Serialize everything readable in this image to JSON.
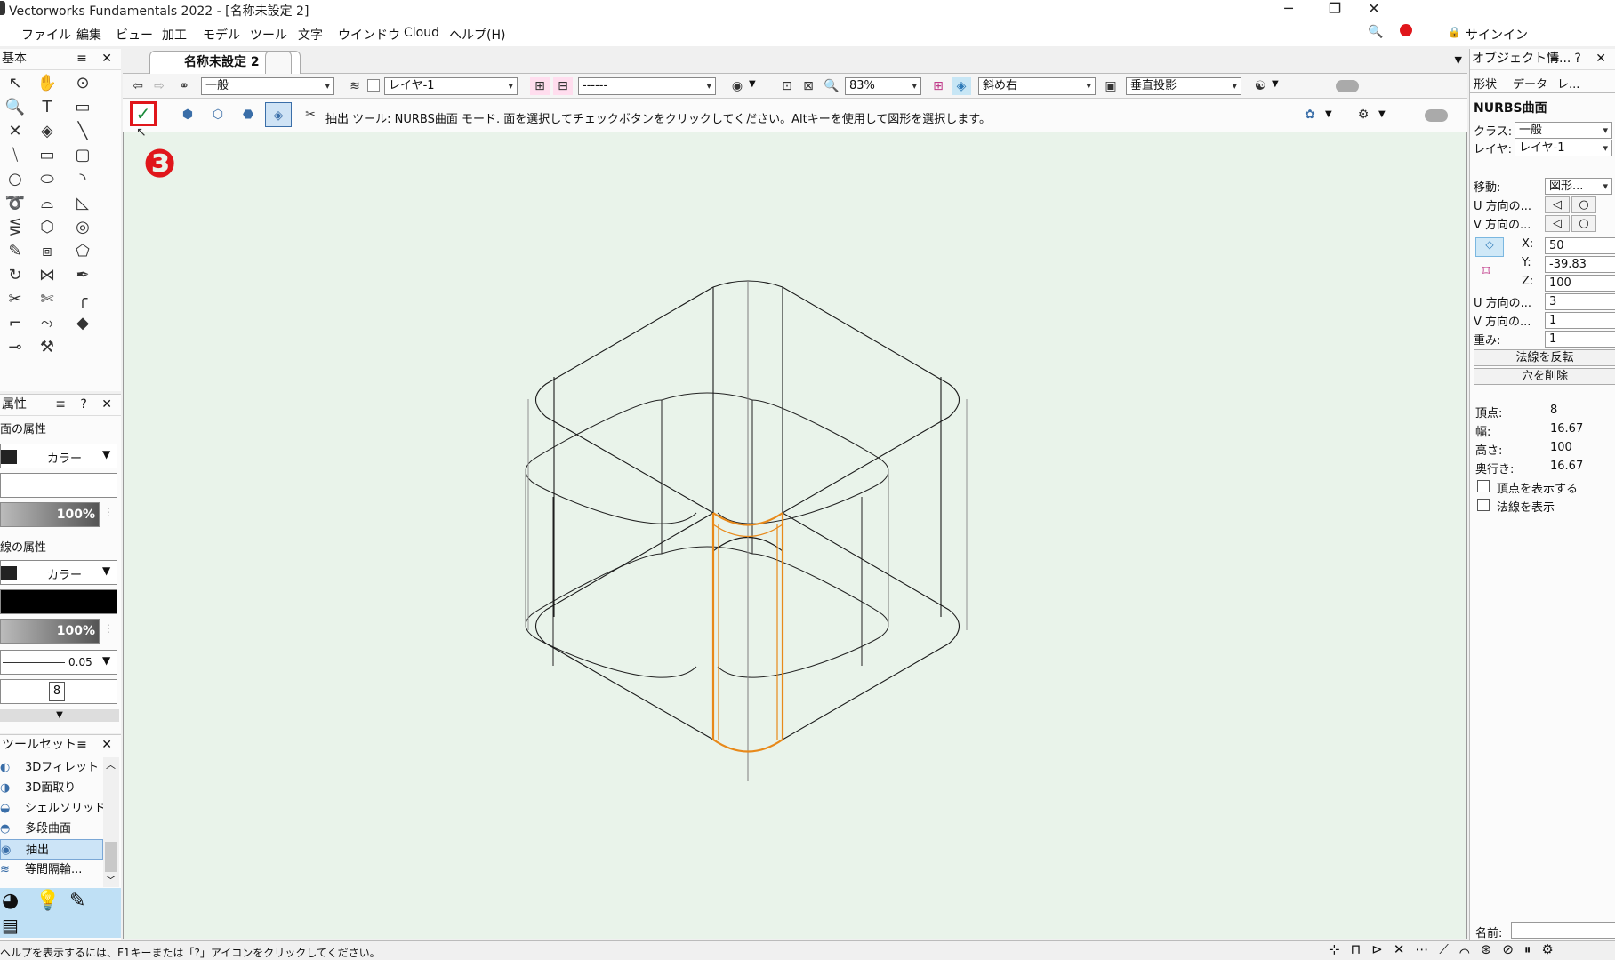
{
  "window": {
    "title": "Vectorworks Fundamentals 2022 - [名称未設定 2]",
    "minimize": "─",
    "restore": "❐",
    "close": "✕"
  },
  "menu": [
    "ファイル",
    "編集",
    "ビュー",
    "加工",
    "モデル",
    "ツール",
    "文字",
    "ウインドウ",
    "Cloud",
    "ヘルプ(H)"
  ],
  "menu_right": {
    "signin": "サインイン"
  },
  "basic_palette": {
    "title": "基本"
  },
  "attributes": {
    "title": "属性",
    "fill_section": "面の属性",
    "fill_type": "カラー",
    "fill_opacity": "100%",
    "pen_section": "線の属性",
    "pen_type": "カラー",
    "pen_opacity": "100%",
    "line_weight": "0.05",
    "marker_value": "8"
  },
  "toolsets": {
    "title": "ツールセット",
    "items": [
      "3Dフィレット",
      "3D面取り",
      "シェルソリッド",
      "多段曲面",
      "抽出",
      "等間隔輪..."
    ]
  },
  "document_tab": {
    "label": "名称未設定 2",
    "close": "✕"
  },
  "view_bar": {
    "class": "一般",
    "layer": "レイヤ-1",
    "saved_view": "------",
    "zoom": "83%",
    "view": "斜め右",
    "projection": "垂直投影"
  },
  "mode_bar": {
    "help_text": "抽出 ツール: NURBS曲面 モード. 面を選択してチェックボタンをクリックしてください。Altキーを使用して図形を選択します。"
  },
  "annotation": {
    "step": "❸"
  },
  "oip": {
    "title": "オブジェクト情...",
    "tabs": [
      "形状",
      "データ",
      "レ..."
    ],
    "object_type": "NURBS曲面",
    "class_label": "クラス:",
    "class_value": "一般",
    "layer_label": "レイヤ:",
    "layer_value": "レイヤ-1",
    "move_label": "移動:",
    "move_value": "図形...",
    "u_dir_label": "U 方向の...",
    "v_dir_label": "V 方向の...",
    "x_label": "X:",
    "x_value": "50",
    "y_label": "Y:",
    "y_value": "-39.83",
    "z_label": "Z:",
    "z_value": "100",
    "u_degree_label": "U 方向の...",
    "u_degree_value": "3",
    "v_degree_label": "V 方向の...",
    "v_degree_value": "1",
    "weight_label": "重み:",
    "weight_value": "1",
    "reverse_normal": "法線を反転",
    "remove_holes": "穴を削除",
    "vertices_label": "頂点:",
    "vertices_value": "8",
    "width_label": "幅:",
    "width_value": "16.67",
    "height_label": "高さ:",
    "height_value": "100",
    "depth_label": "奥行き:",
    "depth_value": "16.67",
    "show_vertices": "頂点を表示する",
    "show_normals": "法線を表示",
    "name_label": "名前:"
  },
  "status": {
    "text": "ヘルプを表示するには、F1キーまたは「?」アイコンをクリックしてください。"
  },
  "colors": {
    "canvas": "#e9f3ea",
    "highlight": "#e8891a",
    "annotation": "#e0161b"
  }
}
